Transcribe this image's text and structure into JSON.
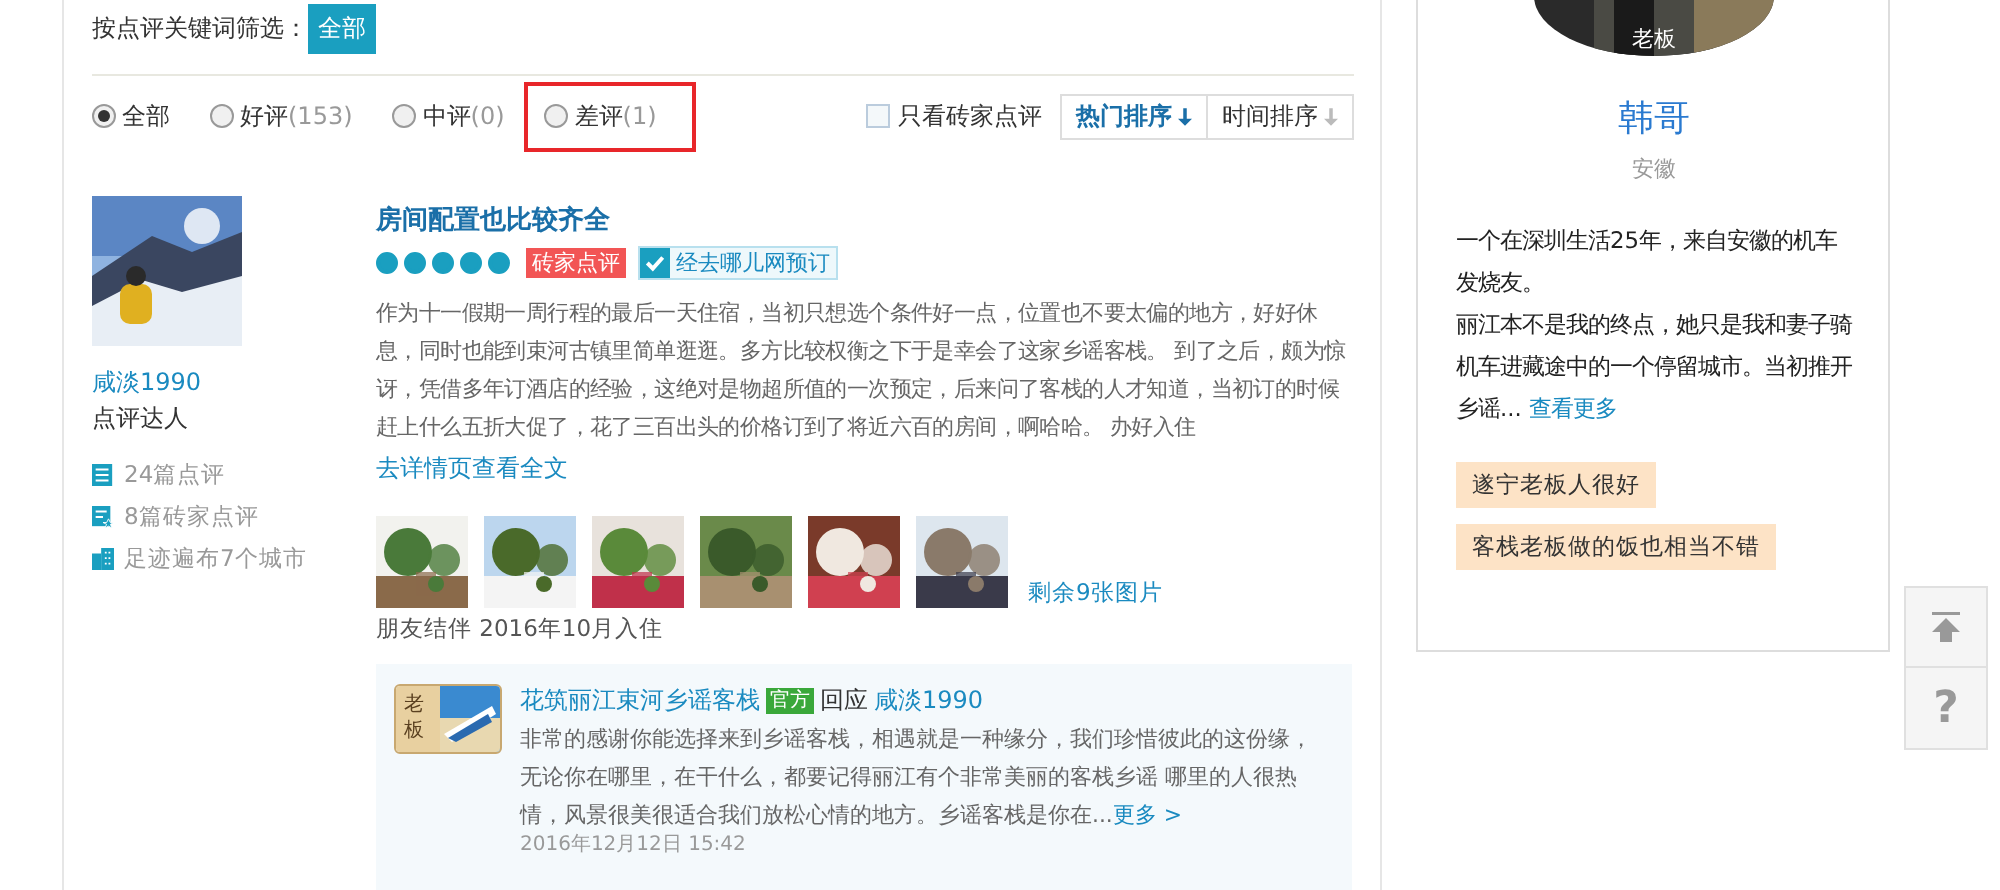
{
  "keyword_filter": {
    "label": "按点评关键词筛选：",
    "tags": [
      {
        "label": "全部",
        "selected": true
      }
    ]
  },
  "rating_filters": [
    {
      "label": "全部",
      "selected": true,
      "highlighted": false
    },
    {
      "label": "好评",
      "count": "(153)",
      "selected": false,
      "highlighted": false
    },
    {
      "label": "中评",
      "count": "(0)",
      "selected": false,
      "highlighted": false
    },
    {
      "label": "差评",
      "count": "(1)",
      "selected": false,
      "highlighted": true
    }
  ],
  "expert_only": {
    "label": "只看砖家点评",
    "checked": false
  },
  "sort_buttons": [
    {
      "label": "热门排序",
      "selected": true
    },
    {
      "label": "时间排序",
      "selected": false
    }
  ],
  "review": {
    "user": {
      "name": "咸淡1990",
      "title": "点评达人",
      "stats": [
        {
          "kind": "reviews",
          "text": "24篇点评"
        },
        {
          "kind": "expert",
          "text": "8篇砖家点评"
        },
        {
          "kind": "cities",
          "text": "足迹遍布7个城市"
        }
      ]
    },
    "title": "房间配置也比较齐全",
    "stars": 5,
    "badge": "砖家点评",
    "booking": {
      "label": "经去哪儿网预订",
      "checked": true
    },
    "text": "作为十一假期一周行程的最后一天住宿，当初只想选个条件好一点，位置也不要太偏的地方，好好休息，同时也能到束河古镇里简单逛逛。多方比较权衡之下于是幸会了这家乡谣客栈。 到了之后，颇为惊讶，凭借多年订酒店的经验，这绝对是物超所值的一次预定，后来问了客栈的人才知道，当初订的时候赶上什么五折大促了，花了三百出头的价格订到了将近六百的房间，啊哈哈。 办好入住",
    "full_link": "去详情页查看全文",
    "photos": [
      {
        "kind": "picture"
      },
      {
        "kind": "picture"
      },
      {
        "kind": "picture"
      },
      {
        "kind": "picture"
      },
      {
        "kind": "picture"
      },
      {
        "kind": "picture"
      }
    ],
    "more_photos": "剩余9张图片",
    "stay": "朋友结伴 2016年10月入住",
    "reply": {
      "avatar_label": "老板",
      "hotel": "花筑丽江束河乡谣客栈",
      "official": "官方",
      "verb": "回应",
      "to": "咸淡1990",
      "text": "非常的感谢你能选择来到乡谣客栈，相遇就是一种缘分，我们珍惜彼此的这份缘，无论你在哪里，在干什么，都要记得丽江有个非常美丽的客栈乡谣 哪里的人很热情，风景很美很适合我们放松心情的地方。乡谣客栈是你在...",
      "more": "更多 >",
      "date": "2016年12月12日 15:42"
    }
  },
  "host": {
    "avatar_label": "老板",
    "name": "韩哥",
    "region": "安徽",
    "bio": [
      "一个在深圳生活25年，来自安徽的机车发烧友。",
      "丽江本不是我的终点，她只是我和妻子骑机车进藏途中的一个停留城市。当初推开乡谣..."
    ],
    "more": "查看更多",
    "tags": [
      "遂宁老板人很好",
      "客栈老板做的饭也相当不错"
    ]
  },
  "float_buttons": [
    {
      "kind": "top"
    },
    {
      "kind": "help",
      "label": "?"
    }
  ]
}
